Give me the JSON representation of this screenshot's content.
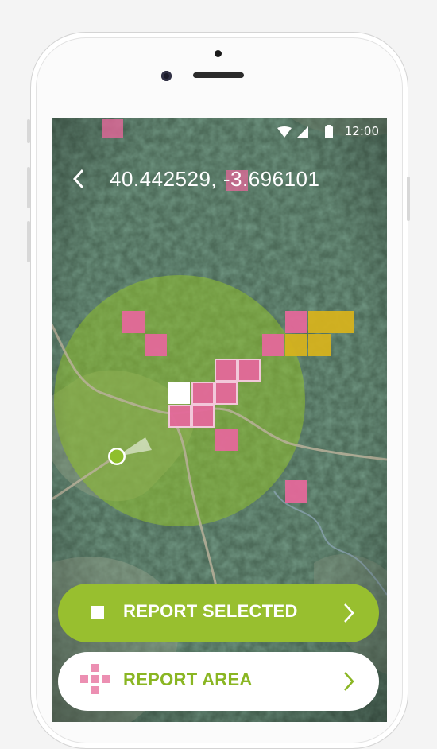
{
  "status_bar": {
    "time": "12:00"
  },
  "header": {
    "coordinates": "40.442529, -3.696101"
  },
  "icons": {
    "back": "chevron-left-icon",
    "wifi": "wifi-icon",
    "signal": "signal-icon",
    "battery": "battery-icon",
    "location": "location-marker-icon",
    "report_selected": "square-icon",
    "report_area": "grid-area-icon",
    "arrow": "chevron-right-icon"
  },
  "colors": {
    "accent_green": "#98bf2f",
    "cell_pink": "#e4689a",
    "cell_yellow": "#d6b21d",
    "cell_selected": "#ffffff"
  },
  "buttons": {
    "report_selected": "REPORT SELECTED",
    "report_area": "REPORT AREA"
  }
}
